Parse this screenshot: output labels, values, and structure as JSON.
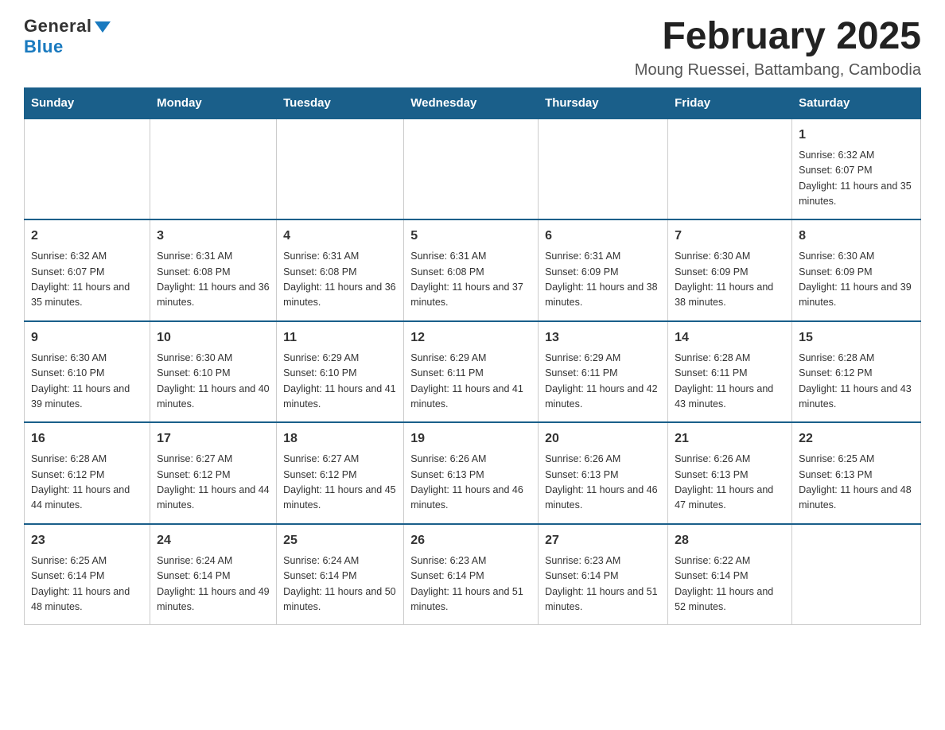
{
  "logo": {
    "general": "General",
    "blue": "Blue"
  },
  "header": {
    "title": "February 2025",
    "subtitle": "Moung Ruessei, Battambang, Cambodia"
  },
  "weekdays": [
    "Sunday",
    "Monday",
    "Tuesday",
    "Wednesday",
    "Thursday",
    "Friday",
    "Saturday"
  ],
  "weeks": [
    [
      {
        "day": "",
        "sunrise": "",
        "sunset": "",
        "daylight": ""
      },
      {
        "day": "",
        "sunrise": "",
        "sunset": "",
        "daylight": ""
      },
      {
        "day": "",
        "sunrise": "",
        "sunset": "",
        "daylight": ""
      },
      {
        "day": "",
        "sunrise": "",
        "sunset": "",
        "daylight": ""
      },
      {
        "day": "",
        "sunrise": "",
        "sunset": "",
        "daylight": ""
      },
      {
        "day": "",
        "sunrise": "",
        "sunset": "",
        "daylight": ""
      },
      {
        "day": "1",
        "sunrise": "Sunrise: 6:32 AM",
        "sunset": "Sunset: 6:07 PM",
        "daylight": "Daylight: 11 hours and 35 minutes."
      }
    ],
    [
      {
        "day": "2",
        "sunrise": "Sunrise: 6:32 AM",
        "sunset": "Sunset: 6:07 PM",
        "daylight": "Daylight: 11 hours and 35 minutes."
      },
      {
        "day": "3",
        "sunrise": "Sunrise: 6:31 AM",
        "sunset": "Sunset: 6:08 PM",
        "daylight": "Daylight: 11 hours and 36 minutes."
      },
      {
        "day": "4",
        "sunrise": "Sunrise: 6:31 AM",
        "sunset": "Sunset: 6:08 PM",
        "daylight": "Daylight: 11 hours and 36 minutes."
      },
      {
        "day": "5",
        "sunrise": "Sunrise: 6:31 AM",
        "sunset": "Sunset: 6:08 PM",
        "daylight": "Daylight: 11 hours and 37 minutes."
      },
      {
        "day": "6",
        "sunrise": "Sunrise: 6:31 AM",
        "sunset": "Sunset: 6:09 PM",
        "daylight": "Daylight: 11 hours and 38 minutes."
      },
      {
        "day": "7",
        "sunrise": "Sunrise: 6:30 AM",
        "sunset": "Sunset: 6:09 PM",
        "daylight": "Daylight: 11 hours and 38 minutes."
      },
      {
        "day": "8",
        "sunrise": "Sunrise: 6:30 AM",
        "sunset": "Sunset: 6:09 PM",
        "daylight": "Daylight: 11 hours and 39 minutes."
      }
    ],
    [
      {
        "day": "9",
        "sunrise": "Sunrise: 6:30 AM",
        "sunset": "Sunset: 6:10 PM",
        "daylight": "Daylight: 11 hours and 39 minutes."
      },
      {
        "day": "10",
        "sunrise": "Sunrise: 6:30 AM",
        "sunset": "Sunset: 6:10 PM",
        "daylight": "Daylight: 11 hours and 40 minutes."
      },
      {
        "day": "11",
        "sunrise": "Sunrise: 6:29 AM",
        "sunset": "Sunset: 6:10 PM",
        "daylight": "Daylight: 11 hours and 41 minutes."
      },
      {
        "day": "12",
        "sunrise": "Sunrise: 6:29 AM",
        "sunset": "Sunset: 6:11 PM",
        "daylight": "Daylight: 11 hours and 41 minutes."
      },
      {
        "day": "13",
        "sunrise": "Sunrise: 6:29 AM",
        "sunset": "Sunset: 6:11 PM",
        "daylight": "Daylight: 11 hours and 42 minutes."
      },
      {
        "day": "14",
        "sunrise": "Sunrise: 6:28 AM",
        "sunset": "Sunset: 6:11 PM",
        "daylight": "Daylight: 11 hours and 43 minutes."
      },
      {
        "day": "15",
        "sunrise": "Sunrise: 6:28 AM",
        "sunset": "Sunset: 6:12 PM",
        "daylight": "Daylight: 11 hours and 43 minutes."
      }
    ],
    [
      {
        "day": "16",
        "sunrise": "Sunrise: 6:28 AM",
        "sunset": "Sunset: 6:12 PM",
        "daylight": "Daylight: 11 hours and 44 minutes."
      },
      {
        "day": "17",
        "sunrise": "Sunrise: 6:27 AM",
        "sunset": "Sunset: 6:12 PM",
        "daylight": "Daylight: 11 hours and 44 minutes."
      },
      {
        "day": "18",
        "sunrise": "Sunrise: 6:27 AM",
        "sunset": "Sunset: 6:12 PM",
        "daylight": "Daylight: 11 hours and 45 minutes."
      },
      {
        "day": "19",
        "sunrise": "Sunrise: 6:26 AM",
        "sunset": "Sunset: 6:13 PM",
        "daylight": "Daylight: 11 hours and 46 minutes."
      },
      {
        "day": "20",
        "sunrise": "Sunrise: 6:26 AM",
        "sunset": "Sunset: 6:13 PM",
        "daylight": "Daylight: 11 hours and 46 minutes."
      },
      {
        "day": "21",
        "sunrise": "Sunrise: 6:26 AM",
        "sunset": "Sunset: 6:13 PM",
        "daylight": "Daylight: 11 hours and 47 minutes."
      },
      {
        "day": "22",
        "sunrise": "Sunrise: 6:25 AM",
        "sunset": "Sunset: 6:13 PM",
        "daylight": "Daylight: 11 hours and 48 minutes."
      }
    ],
    [
      {
        "day": "23",
        "sunrise": "Sunrise: 6:25 AM",
        "sunset": "Sunset: 6:14 PM",
        "daylight": "Daylight: 11 hours and 48 minutes."
      },
      {
        "day": "24",
        "sunrise": "Sunrise: 6:24 AM",
        "sunset": "Sunset: 6:14 PM",
        "daylight": "Daylight: 11 hours and 49 minutes."
      },
      {
        "day": "25",
        "sunrise": "Sunrise: 6:24 AM",
        "sunset": "Sunset: 6:14 PM",
        "daylight": "Daylight: 11 hours and 50 minutes."
      },
      {
        "day": "26",
        "sunrise": "Sunrise: 6:23 AM",
        "sunset": "Sunset: 6:14 PM",
        "daylight": "Daylight: 11 hours and 51 minutes."
      },
      {
        "day": "27",
        "sunrise": "Sunrise: 6:23 AM",
        "sunset": "Sunset: 6:14 PM",
        "daylight": "Daylight: 11 hours and 51 minutes."
      },
      {
        "day": "28",
        "sunrise": "Sunrise: 6:22 AM",
        "sunset": "Sunset: 6:14 PM",
        "daylight": "Daylight: 11 hours and 52 minutes."
      },
      {
        "day": "",
        "sunrise": "",
        "sunset": "",
        "daylight": ""
      }
    ]
  ]
}
